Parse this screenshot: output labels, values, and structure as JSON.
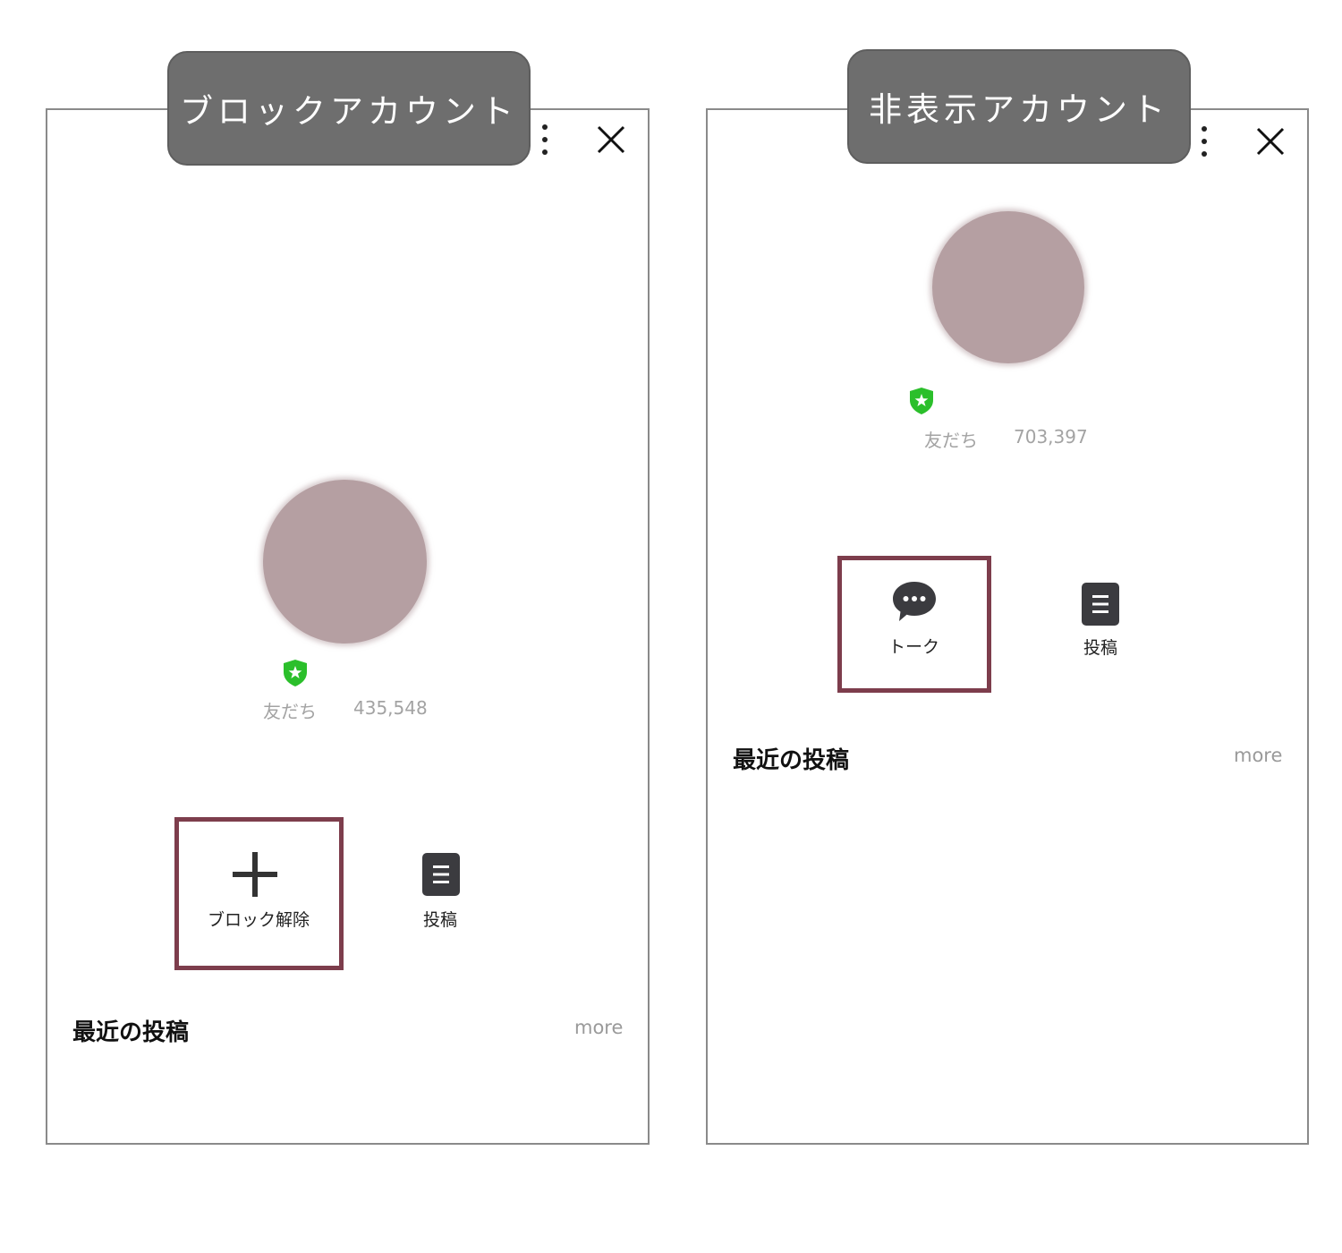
{
  "left": {
    "tag": "ブロックアカウント",
    "friends_label": "友だち",
    "friends_count": "435,548",
    "primary_action": "ブロック解除",
    "posts_action": "投稿",
    "section_title": "最近の投稿",
    "more": "more"
  },
  "right": {
    "tag": "非表示アカウント",
    "friends_label": "友だち",
    "friends_count": "703,397",
    "primary_action": "トーク",
    "posts_action": "投稿",
    "section_title": "最近の投稿",
    "more": "more"
  },
  "colors": {
    "tag_bg": "#6e6e6e",
    "highlight": "#7d3d4c",
    "avatar": "#b59fa2",
    "shield": "#2bbf2b"
  }
}
